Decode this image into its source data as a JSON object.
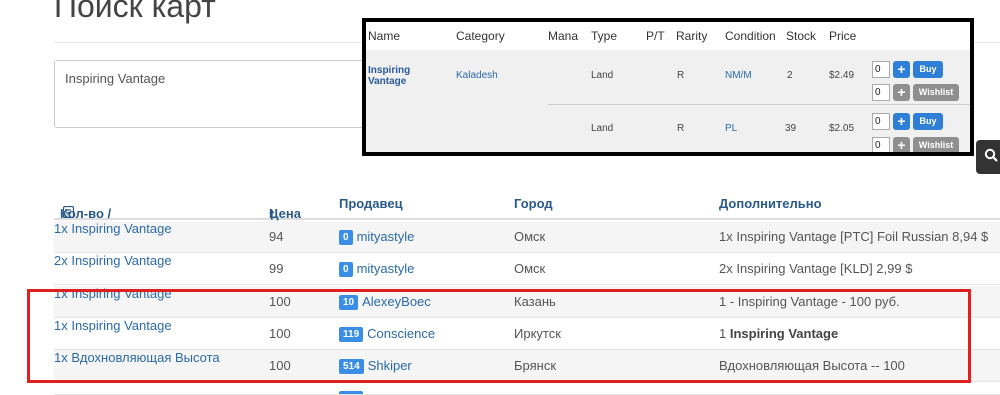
{
  "page": {
    "title": "Поиск карт"
  },
  "search": {
    "query": "Inspiring Vantage"
  },
  "overlay": {
    "headers": [
      "Name",
      "Category",
      "Mana",
      "Type",
      "P/T",
      "Rarity",
      "Condition",
      "Stock",
      "Price"
    ],
    "card_name": "Inspiring Vantage",
    "category": "Kaladesh",
    "offers": [
      {
        "type": "Land",
        "rarity": "R",
        "condition": "NM/M",
        "stock": "2",
        "price": "$2.49",
        "qty_buy": "0",
        "qty_wish": "0"
      },
      {
        "type": "Land",
        "rarity": "R",
        "condition": "PL",
        "stock": "39",
        "price": "$2.05",
        "qty_buy": "0",
        "qty_wish": "0"
      }
    ],
    "buy_label": "Buy",
    "wishlist_label": "Wishlist",
    "plus_glyph": "+"
  },
  "table": {
    "headers": {
      "name": "Кол-во / Название",
      "price": "Цена",
      "seller": "Продавец",
      "city": "Город",
      "extra": "Дополнительно"
    },
    "rows": [
      {
        "name": "1x Inspiring Vantage",
        "price": "94",
        "badge": "0",
        "seller": "mityastyle",
        "city": "Омск",
        "extra": "1x Inspiring Vantage [PTC] Foil Russian 8,94 $",
        "extra_bold": ""
      },
      {
        "name": "2x Inspiring Vantage",
        "price": "99",
        "badge": "0",
        "seller": "mityastyle",
        "city": "Омск",
        "extra": "2x Inspiring Vantage [KLD] 2,99 $",
        "extra_bold": ""
      },
      {
        "name": "1x Inspiring Vantage",
        "price": "100",
        "badge": "10",
        "seller": "AlexeyBoec",
        "city": "Казань",
        "extra": "1 - Inspiring Vantage - 100 руб.",
        "extra_bold": ""
      },
      {
        "name": "1x Inspiring Vantage",
        "price": "100",
        "badge": "119",
        "seller": "Conscience",
        "city": "Иркутск",
        "extra": "1 ",
        "extra_bold": "Inspiring Vantage"
      },
      {
        "name": "1x Вдохновляющая Высота",
        "price": "100",
        "badge": "514",
        "seller": "Shkiper",
        "city": "Брянск",
        "extra": "Вдохновляющая Высота -- 100",
        "extra_bold": ""
      }
    ]
  },
  "colors": {
    "accent": "#2f7fd6",
    "badge": "#3a8ee6",
    "highlight": "#e02020",
    "link": "#2a6aa8"
  },
  "icons": {
    "search": "search-icon",
    "sort": "sort-up-arrow-icon",
    "list": "list-icon",
    "star": "star-icon",
    "plus": "plus-icon"
  }
}
